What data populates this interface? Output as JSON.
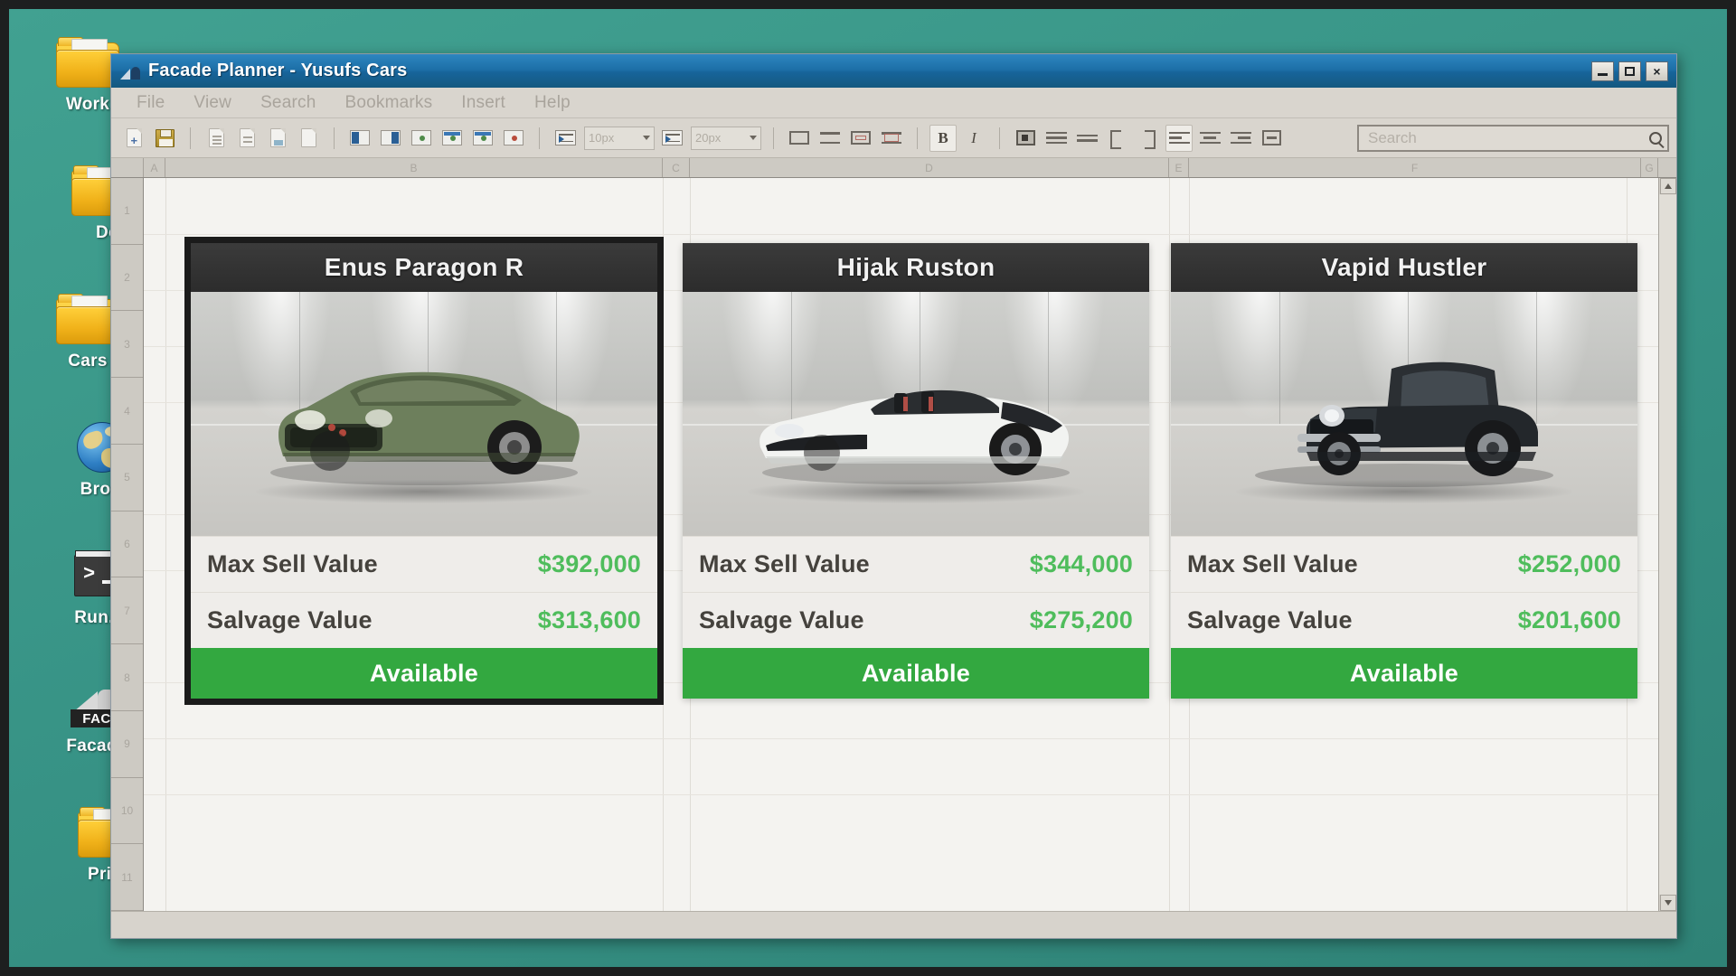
{
  "desktop": {
    "icons": [
      {
        "label": "Work",
        "icon": "folder-icon"
      },
      {
        "label": "Do",
        "icon": "folder-icon"
      },
      {
        "label": "Cars",
        "icon": "folder-icon"
      },
      {
        "label": "Brow",
        "icon": "globe-browser-icon"
      },
      {
        "label": "Run.C",
        "icon": "terminal-icon"
      },
      {
        "label": "Facade",
        "icon": "facade-app-icon"
      },
      {
        "label": "Priva",
        "icon": "folder-icon"
      }
    ]
  },
  "window": {
    "title": "Facade Planner - Yusufs Cars",
    "app_icon": "facade-app-icon",
    "controls": {
      "minimize": "minimize-icon",
      "maximize": "maximize-icon",
      "close": "×"
    }
  },
  "menubar": {
    "items": [
      "File",
      "View",
      "Search",
      "Bookmarks",
      "Insert",
      "Help"
    ]
  },
  "toolbar": {
    "new_label": "new-document-icon",
    "save_label": "save-floppy-icon",
    "selects": [
      {
        "name": "line-spacing-select",
        "value": "10px"
      },
      {
        "name": "paragraph-spacing-select",
        "value": "20px"
      }
    ],
    "bold_label": "B",
    "italic_label": "I"
  },
  "search": {
    "placeholder": "Search",
    "value": "",
    "icon": "search-icon"
  },
  "sheet": {
    "columns": [
      "A",
      "B",
      "C",
      "D",
      "E",
      "F",
      "G"
    ],
    "rows": [
      "1",
      "2",
      "3",
      "4",
      "5",
      "6",
      "7",
      "8",
      "9",
      "10",
      "11"
    ]
  },
  "colors": {
    "accent_green": "#4fbd5c",
    "status_green": "#33a840",
    "title_blue": "#1c6ea6",
    "desktop_teal": "#3e9e8d",
    "card_header_dark": "#2c2c2c"
  },
  "cards": [
    {
      "name": "Enus Paragon R",
      "selected": true,
      "body_color": "#6d7f5c",
      "rows": [
        {
          "label": "Max Sell Value",
          "value": "$392,000"
        },
        {
          "label": "Salvage Value",
          "value": "$313,600"
        }
      ],
      "status": "Available"
    },
    {
      "name": "Hijak Ruston",
      "selected": false,
      "body_color": "#f2f3f1",
      "rows": [
        {
          "label": "Max Sell Value",
          "value": "$344,000"
        },
        {
          "label": "Salvage Value",
          "value": "$275,200"
        }
      ],
      "status": "Available"
    },
    {
      "name": "Vapid Hustler",
      "selected": false,
      "body_color": "#2b2f33",
      "rows": [
        {
          "label": "Max Sell Value",
          "value": "$252,000"
        },
        {
          "label": "Salvage Value",
          "value": "$201,600"
        }
      ],
      "status": "Available"
    }
  ]
}
